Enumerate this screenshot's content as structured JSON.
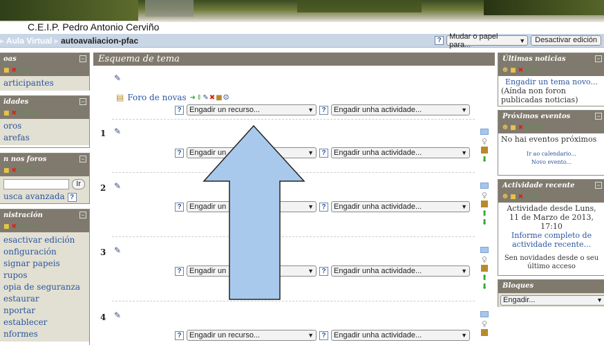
{
  "header": {
    "site_name": "C.E.I.P. Pedro Antonio Cerviño"
  },
  "navbar": {
    "crumb_root": "Aula Virtual",
    "crumb_sep": "▸",
    "crumb_course": "autoavaliacion-pfac",
    "role_select": "Mudar o papel para...",
    "edit_button": "Desactivar edición",
    "help": "?"
  },
  "left": {
    "people": {
      "title": "oas",
      "links": [
        "articipantes"
      ]
    },
    "activities": {
      "title": "idades",
      "links": [
        "oros",
        "arefas"
      ]
    },
    "search": {
      "title": "n nos foros",
      "go": "Ir",
      "advanced": "usca avanzada",
      "help": "?"
    },
    "admin": {
      "title": "nistración",
      "links": [
        "esactivar edición",
        "onfiguración",
        "signar papeis",
        "rupos",
        "opia de seguranza",
        "estaurar",
        "nportar",
        "establecer",
        "nformes"
      ]
    }
  },
  "main": {
    "title": "Esquema de tema",
    "forum": "Foro de novas",
    "add_resource": "Engadir un recurso...",
    "add_resource_short": "Engadir un",
    "add_activity": "Engadir unha actividade...",
    "help": "?",
    "sections": [
      "1",
      "2",
      "3",
      "4"
    ]
  },
  "right": {
    "news": {
      "title": "Últimas noticias",
      "link": "Engadir un tema novo...",
      "text": "(Aínda non foron publicadas noticias)"
    },
    "events": {
      "title": "Próximos eventos",
      "text": "No hai eventos próximos",
      "cal": "Ir ao calendario...",
      "new": "Novo evento..."
    },
    "recent": {
      "title": "Actividade recente",
      "since": "Actividade desde Luns, 11 de Marzo de 2013, 17:10",
      "report": "Informe completo de actividade recente...",
      "none": "Sen novidades desde o seu último acceso"
    },
    "blocks": {
      "title": "Bloques",
      "select": "Engadir..."
    }
  },
  "colors": {
    "block_header": "#807a6e",
    "block_body": "#e2e0d2",
    "navbar": "#c9d6e6",
    "link": "#2a55a0",
    "arrow_fill": "#a9c9ec"
  }
}
